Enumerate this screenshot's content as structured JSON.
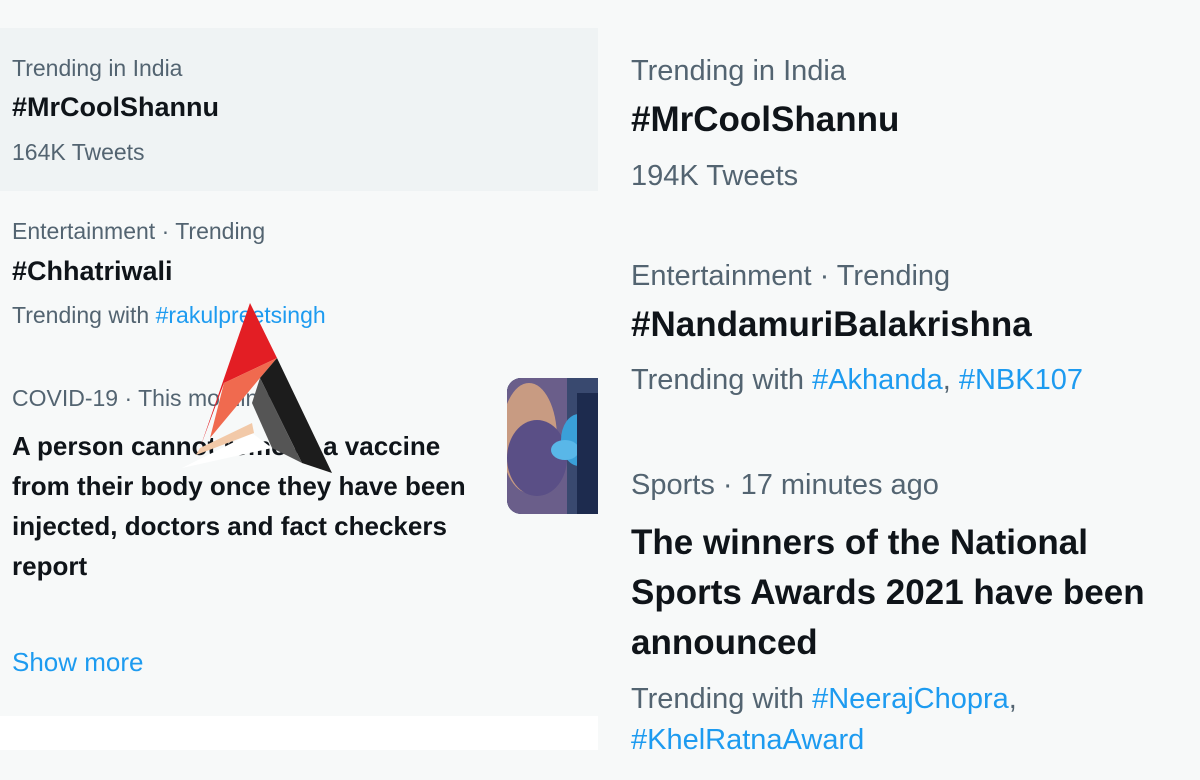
{
  "left": {
    "trend1": {
      "meta": "Trending in India",
      "title": "#MrCoolShannu",
      "count": "164K Tweets"
    },
    "trend2": {
      "meta": "Entertainment · Trending",
      "title": "#Chhatriwali",
      "trending_with_label": "Trending with",
      "hashtag": "#rakulpreetsingh"
    },
    "news": {
      "meta": "COVID-19 · This morning",
      "headline": "A person cannot remove a vaccine from their body once they have been injected, doctors and fact checkers report"
    },
    "show_more": "Show more"
  },
  "right": {
    "trend1": {
      "meta": "Trending in India",
      "title": "#MrCoolShannu",
      "count": "194K Tweets"
    },
    "trend2": {
      "meta": "Entertainment · Trending",
      "title": "#NandamuriBalakrishna",
      "trending_with_label": "Trending with",
      "hashtag1": "#Akhanda",
      "separator": ",",
      "hashtag2": "#NBK107"
    },
    "news": {
      "meta": "Sports · 17 minutes ago",
      "headline": "The winners of the National Sports Awards 2021 have been announced",
      "trending_with_label": "Trending with",
      "hashtag1": "#NeerajChopra",
      "separator": ",",
      "hashtag2": "#KhelRatnaAward"
    }
  },
  "colors": {
    "link": "#1d9bf0",
    "muted": "#536471",
    "text": "#0f1419",
    "hover_bg": "#eff3f4",
    "page_bg": "#f7f9f9"
  }
}
